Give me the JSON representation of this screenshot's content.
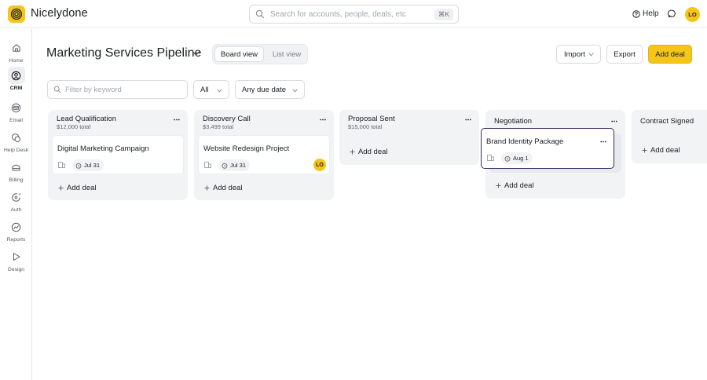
{
  "app": {
    "name": "Nicelydone"
  },
  "search": {
    "placeholder": "Search for accounts, people, deals, etc",
    "shortcut": "⌘K"
  },
  "topbar": {
    "help_label": "Help",
    "user_initials": "LO"
  },
  "sidebar": {
    "items": [
      {
        "label": "Home",
        "icon": "home-icon",
        "active": false
      },
      {
        "label": "CRM",
        "icon": "crm-icon",
        "active": true
      },
      {
        "label": "Email",
        "icon": "email-icon",
        "active": false
      },
      {
        "label": "Help Desk",
        "icon": "helpdesk-icon",
        "active": false
      },
      {
        "label": "Billing",
        "icon": "billing-icon",
        "active": false
      },
      {
        "label": "Auth",
        "icon": "auth-icon",
        "active": false
      },
      {
        "label": "Reports",
        "icon": "reports-icon",
        "active": false
      },
      {
        "label": "Design",
        "icon": "design-icon",
        "active": false
      }
    ]
  },
  "header": {
    "title": "Marketing Services Pipeline",
    "views": {
      "board": "Board view",
      "list": "List view",
      "active": "board"
    },
    "import_label": "Import",
    "export_label": "Export",
    "add_deal_label": "Add deal"
  },
  "filters": {
    "keyword_placeholder": "Filter by keyword",
    "owner": "All",
    "due": "Any due date"
  },
  "colors": {
    "accent": "#f5c518",
    "selected_border": "#3c2a63",
    "column_bg": "#f2f3f5"
  },
  "columns": [
    {
      "title": "Lead Qualification",
      "total": "$12,000 total",
      "cards": [
        {
          "title": "Digital Marketing Campaign",
          "date": "Jul 31",
          "owner": ""
        }
      ],
      "add_label": "Add deal"
    },
    {
      "title": "Discovery Call",
      "total": "$3,499 total",
      "cards": [
        {
          "title": "Website Redesign Project",
          "date": "Jul 31",
          "owner": "LO"
        }
      ],
      "add_label": "Add deal"
    },
    {
      "title": "Proposal Sent",
      "total": "$15,000 total",
      "cards": [],
      "add_label": "Add deal"
    },
    {
      "title": "Negotiation",
      "total": "",
      "cards": [
        {
          "title": "Brand Identity Package",
          "date": "Aug 1",
          "owner": ""
        }
      ],
      "add_label": "Add deal"
    },
    {
      "title": "Contract Signed",
      "total": "",
      "cards": [],
      "add_label": "Add deal"
    }
  ]
}
